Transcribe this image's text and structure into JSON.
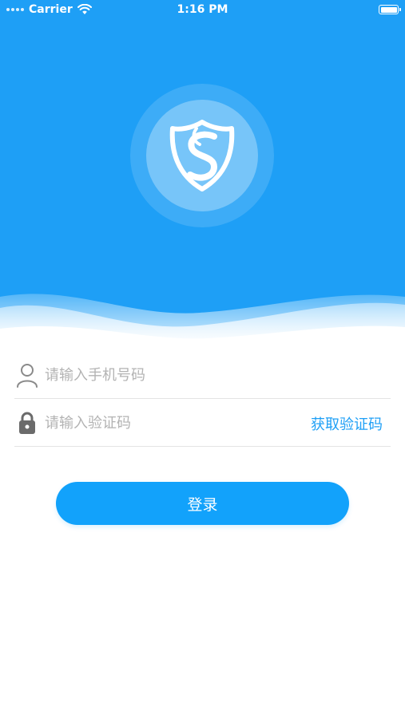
{
  "status_bar": {
    "carrier": "Carrier",
    "time": "1:16 PM",
    "wifi_icon": "wifi-icon",
    "battery_icon": "battery-icon"
  },
  "header": {
    "logo_icon": "shield-s-logo-icon",
    "background_color": "#1e9ff6"
  },
  "form": {
    "phone": {
      "icon": "user-icon",
      "placeholder": "请输入手机号码",
      "value": ""
    },
    "code": {
      "icon": "lock-icon",
      "placeholder": "请输入验证码",
      "value": "",
      "get_code_label": "获取验证码"
    }
  },
  "login_button": {
    "label": "登录",
    "color": "#12a2fb"
  }
}
